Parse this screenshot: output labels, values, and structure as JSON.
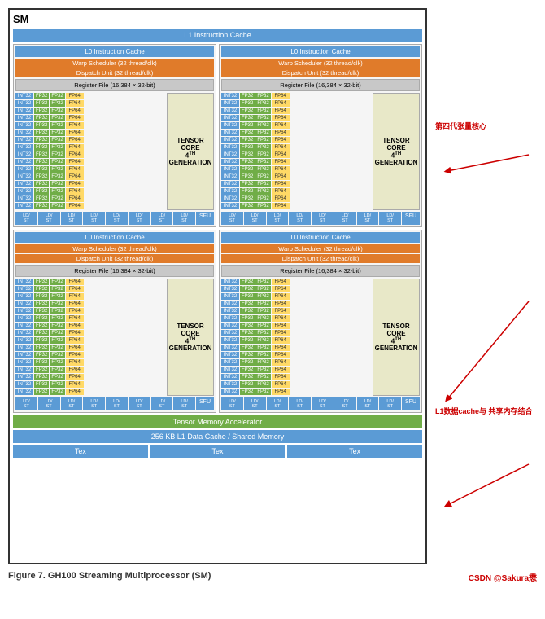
{
  "diagram": {
    "title": "SM",
    "l1_instruction_cache": "L1 Instruction Cache",
    "l0_instruction_cache": "L0 Instruction Cache",
    "warp_scheduler": "Warp Scheduler (32 thread/clk)",
    "dispatch_unit": "Dispatch Unit (32 thread/clk)",
    "register_file": "Register File (16,384 × 32-bit)",
    "tensor_core_label": "TENSOR CORE",
    "tensor_core_gen_num": "4",
    "tensor_core_gen_sup": "TH",
    "tensor_core_gen_text": "GENERATION",
    "sfu": "SFU",
    "tensor_memory_accelerator": "Tensor Memory Accelerator",
    "l1_data_cache": "256 KB L1 Data Cache / Shared Memory",
    "tex": "Tex"
  },
  "annotations": {
    "fourth_gen_label": "第四代张量核心",
    "l1_cache_label": "L1数据cache与\n共享内存结合"
  },
  "caption": {
    "figure_number": "Figure 7.",
    "title": "    GH100 Streaming Multiprocessor (SM)",
    "credit": "CSDN @Sakura懋"
  }
}
